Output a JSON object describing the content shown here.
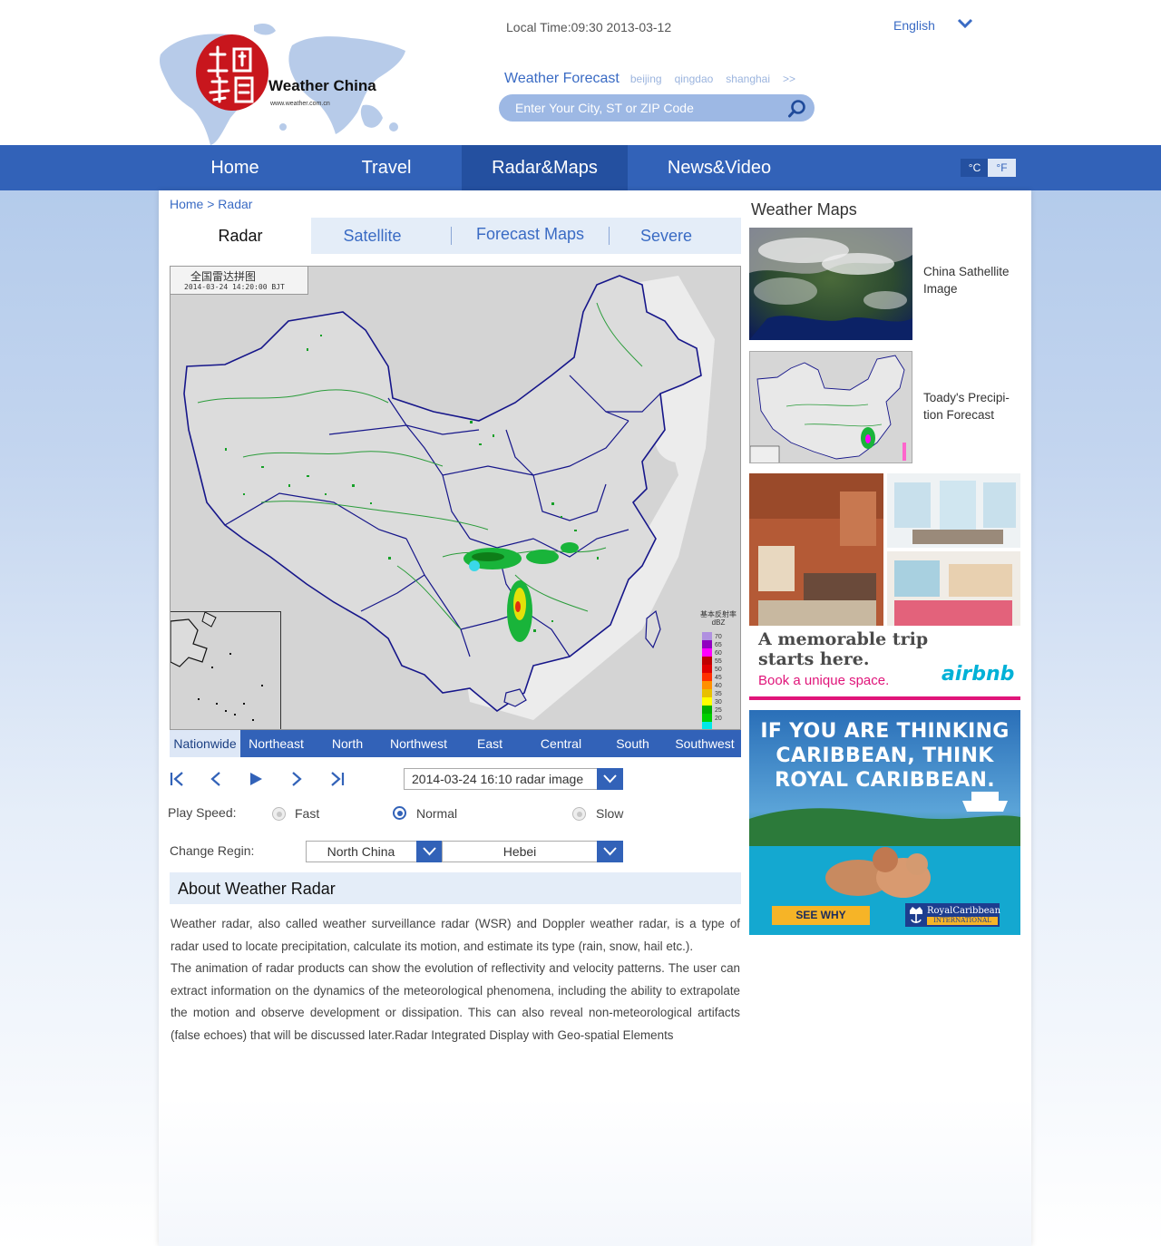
{
  "header": {
    "logo_text": "Weather China",
    "logo_url_text": "www.weather.com.cn",
    "local_time": "Local Time:09:30  2013-03-12",
    "language": "English",
    "forecast_title": "Weather Forecast",
    "forecast_cities": [
      "beijing",
      "qingdao",
      "shanghai",
      ">>"
    ],
    "search_placeholder": "Enter Your City, ST or ZIP Code"
  },
  "nav": {
    "items": [
      "Home",
      "Travel",
      "Radar&Maps",
      "News&Video"
    ],
    "active": "Radar&Maps",
    "unit_c": "°C",
    "unit_f": "°F"
  },
  "breadcrumb": "Home > Radar",
  "subtabs": {
    "items": [
      "Radar",
      "Satellite",
      "Forecast Maps",
      "Severe"
    ],
    "active": "Radar"
  },
  "map": {
    "stamp_title": "全国雷达拼图",
    "stamp_time": "2014-03-24 14:20:00 BJT",
    "legend_title": "基本反射率",
    "legend_unit": "dBZ",
    "legend_values": [
      "70",
      "65",
      "60",
      "55",
      "50",
      "45",
      "40",
      "35",
      "30",
      "25",
      "20"
    ],
    "legend_colors": [
      "#b090e0",
      "#9000c0",
      "#ff00ff",
      "#c00000",
      "#e00000",
      "#ff3000",
      "#ff9000",
      "#e8c000",
      "#ffff00",
      "#00b000",
      "#00d000",
      "#00e8e8"
    ]
  },
  "regions": {
    "items": [
      "Nationwide",
      "Northeast",
      "North",
      "Northwest",
      "East",
      "Central",
      "South",
      "Southwest"
    ],
    "active": "Nationwide"
  },
  "controls": {
    "first": "|<",
    "prev": "<",
    "play": "▶",
    "next": ">",
    "last": ">|",
    "radar_image_select": "2014-03-24 16:10 radar image",
    "play_speed_label": "Play Speed:",
    "speeds": [
      "Fast",
      "Normal",
      "Slow"
    ],
    "speed_selected": "Normal",
    "change_region_label": "Change Regin:",
    "region_select": "North China",
    "province_select": "Hebei"
  },
  "about": {
    "title": "About Weather Radar",
    "para1": "Weather radar, also called weather surveillance radar (WSR) and Doppler weather radar, is a type of radar used to locate precipitation, calculate its motion, and estimate its type (rain, snow, hail etc.).",
    "para2": "The animation of radar products can show the evolution of reflectivity and velocity patterns. The user can extract information on the dynamics of the meteorological phenomena, including the ability to extrapolate the motion and observe development or dissipation. This can also reveal non-meteorological artifacts (false echoes) that will be discussed later.Radar Integrated Display with Geo-spatial Elements"
  },
  "sidebar": {
    "title": "Weather Maps",
    "maps": [
      {
        "caption": "China Sathellite Image"
      },
      {
        "caption": "Toady's Precipi-tion Forecast"
      }
    ],
    "ad1": {
      "line1": "A memorable trip",
      "line2": "starts here.",
      "sub": "Book a unique space.",
      "brand": "airbnb"
    },
    "ad2": {
      "line1": "IF YOU ARE THINKING",
      "line2": "CARIBBEAN, THINK",
      "line3": "ROYAL CARIBBEAN.",
      "button": "SEE WHY",
      "brand": "RoyalCaribbean",
      "brand_sub": "INTERNATIONAL"
    }
  }
}
